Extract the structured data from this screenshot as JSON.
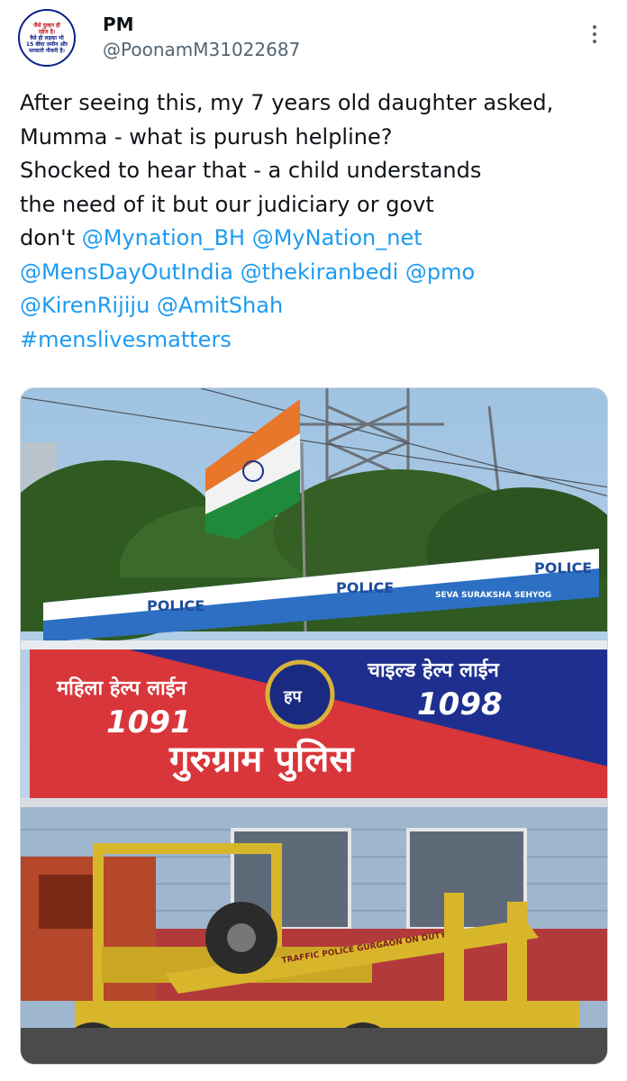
{
  "tweet": {
    "author_name": "PM",
    "handle": "@PoonamM31022687",
    "avatar_lines": [
      "जैसे दुल्हन ही",
      "दहेज है।",
      "वैसे ही लड़का भी",
      "15 बीघा जमीन और",
      "सरकारी नौकरी है।"
    ],
    "more_icon": "more-options-icon",
    "text": {
      "line1": "After seeing this, my 7 years old daughter asked,",
      "line2": "Mumma - what is purush helpline?",
      "line3": "Shocked to hear that - a child understands",
      "line4": "the need of it but our judiciary or govt",
      "line5_prefix": "don't ",
      "mention_mynation_bh": "@Mynation_BH",
      "mention_mynation_net": "@MyNation_net",
      "mention_mensdayout": "@MensDayOutIndia",
      "mention_kiranbedi": "@thekiranbedi",
      "mention_pmo": "@pmo",
      "mention_rijiju": "@KirenRijiju",
      "mention_amitshah": "@AmitShah",
      "hashtag": "#menslivesmatters"
    }
  },
  "photo": {
    "police_banner_1": "POLICE",
    "police_banner_2": "POLICE",
    "police_banner_3": "POLICE",
    "police_banner_sub": "SEVA   SURAKSHA   SEHYOG",
    "women_helpline": "महिला हेल्प लाईन",
    "women_number": "1091",
    "child_helpline": "चाइल्ड हेल्प लाईन",
    "child_number": "1098",
    "emblem_text": "हप",
    "station_name": "गुरुग्राम पुलिस",
    "truck_text": "TRAFFIC POLICE GURGAON ON DUTY"
  },
  "colors": {
    "link": "#1d9bf0",
    "text": "#0f1419",
    "secondary": "#536471",
    "sign_blue": "#1e2f8f",
    "sign_red": "#d8363a",
    "truck_yellow": "#d8b62c"
  }
}
